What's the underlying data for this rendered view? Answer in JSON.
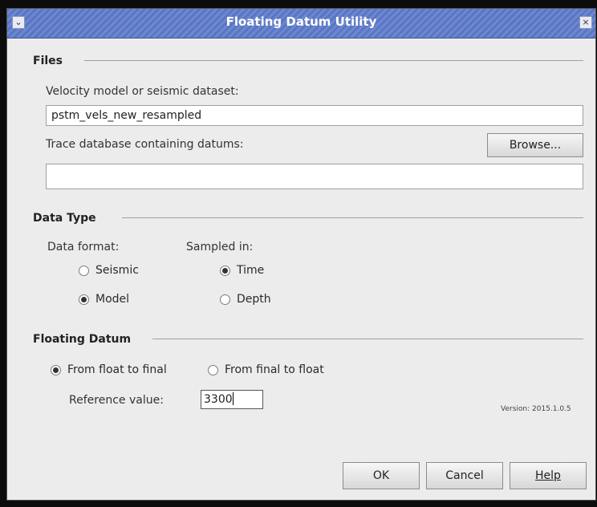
{
  "window": {
    "title": "Floating Datum Utility",
    "menu_icon": "chevron-down-icon",
    "close_icon": "close-icon"
  },
  "files": {
    "section_title": "Files",
    "velocity_label": "Velocity model or seismic dataset:",
    "velocity_value": "pstm_vels_new_resampled",
    "trace_label": "Trace database containing datums:",
    "browse_label": "Browse...",
    "trace_value": ""
  },
  "data_type": {
    "section_title": "Data Type",
    "format_label": "Data format:",
    "format_options": [
      {
        "label": "Seismic",
        "checked": false
      },
      {
        "label": "Model",
        "checked": true
      }
    ],
    "sampled_label": "Sampled in:",
    "sampled_options": [
      {
        "label": "Time",
        "checked": true
      },
      {
        "label": "Depth",
        "checked": false
      }
    ]
  },
  "floating_datum": {
    "section_title": "Floating Datum",
    "direction_options": [
      {
        "label": "From float to final",
        "checked": true
      },
      {
        "label": "From final to float",
        "checked": false
      }
    ],
    "reference_label": "Reference value:",
    "reference_value": "3300"
  },
  "version_text": "Version: 2015.1.0.5",
  "buttons": {
    "ok": "OK",
    "cancel": "Cancel",
    "help": "Help"
  }
}
